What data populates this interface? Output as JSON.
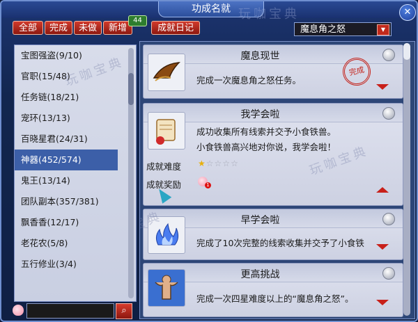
{
  "window": {
    "title": "功成名就",
    "close_label": "✕"
  },
  "filters": [
    {
      "label": "全部"
    },
    {
      "label": "完成"
    },
    {
      "label": "未做"
    },
    {
      "label": "新增",
      "badge": "44"
    },
    {
      "label": "成就日记"
    }
  ],
  "dropdown": {
    "selected": "魔息角之怒",
    "arrow": "▼"
  },
  "sidebar": {
    "items": [
      {
        "label": "宝图强盗(9/10)"
      },
      {
        "label": "官职(15/48)"
      },
      {
        "label": "任务链(18/21)"
      },
      {
        "label": "宠环(13/13)"
      },
      {
        "label": "百晓星君(24/31)"
      },
      {
        "label": "神器(452/574)",
        "active": true
      },
      {
        "label": "鬼王(13/14)"
      },
      {
        "label": "团队副本(357/381)"
      },
      {
        "label": "飘香香(12/17)"
      },
      {
        "label": "老花农(5/8)"
      },
      {
        "label": "五行修业(3/4)"
      }
    ]
  },
  "search": {
    "placeholder": "",
    "button_icon": "search-icon"
  },
  "watermark": {
    "text": "玩咖宝典"
  },
  "achievements": [
    {
      "title": "魔息现世",
      "desc": [
        "完成一次魔息角之怒任务。"
      ],
      "stamp": "完成",
      "icon": "horn-icon"
    },
    {
      "title": "我学会啦",
      "desc": [
        "成功收集所有线索并交予小食铁兽。",
        "小食铁兽高兴地对你说，我学会啦！"
      ],
      "icon": "scroll-icon",
      "difficulty_label": "成就难度",
      "difficulty_stars": 1,
      "difficulty_max": 5,
      "reward_label": "成就奖励",
      "reward_count": "1"
    },
    {
      "title": "早学会啦",
      "desc": [
        "完成了10次完整的线索收集并交予了小食铁"
      ],
      "icon": "blue-flame-icon"
    },
    {
      "title": "更高挑战",
      "desc": [
        "完成一次四星难度以上的“魔息角之怒”。"
      ],
      "icon": "strongman-icon"
    }
  ],
  "colors": {
    "accent_red": "#c8201a",
    "selected": "#3c5fa8",
    "star": "#e8b00c"
  }
}
